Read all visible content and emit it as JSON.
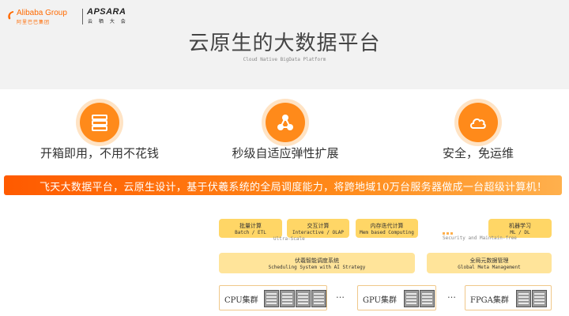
{
  "header": {
    "alibaba_logo_text": "Alibaba Group",
    "alibaba_logo_cn": "阿里巴巴集团",
    "apsara_logo_text": "APSARA",
    "apsara_logo_cn": "云 栖 大 会",
    "title": "云原生的大数据平台",
    "subtitle": "Cloud Native BigData Platform"
  },
  "features": [
    {
      "icon": "server-stack-icon",
      "label": "开箱即用，不用不花钱"
    },
    {
      "icon": "share-nodes-icon",
      "label": "秒级自适应弹性扩展"
    },
    {
      "icon": "cloud-icon",
      "label": "安全，免运维"
    }
  ],
  "banner": {
    "text": "飞天大数据平台，云原生设计，基于伏羲系统的全局调度能力，将跨地域10万台服务器做成一台超级计算机！"
  },
  "architecture": {
    "compute_boxes": [
      {
        "cn": "批量计算",
        "en": "Batch / ETL"
      },
      {
        "cn": "交互计算",
        "en": "Interactive / OLAP"
      },
      {
        "cn": "内存迭代计算",
        "en": "Mem based Computing"
      },
      {
        "cn": "机器学习",
        "en": "ML / DL"
      }
    ],
    "ultra_scale_label": "Ultra-Scale",
    "security_label": "Security and Maintain-free",
    "scheduling": {
      "cn": "伏羲智能调度系统",
      "en": "Scheduling System with AI Strategy"
    },
    "meta": {
      "cn": "全局元数据管理",
      "en": "Global Meta Management"
    },
    "clusters": [
      {
        "label": "CPU集群"
      },
      {
        "label": "GPU集群"
      },
      {
        "label": "FPGA集群"
      }
    ],
    "ellipsis": "…"
  },
  "colors": {
    "accent": "#ff8a1a",
    "banner_start": "#ff5a00",
    "box_fill": "#ffd666",
    "header_bg": "#f2f2f2"
  }
}
